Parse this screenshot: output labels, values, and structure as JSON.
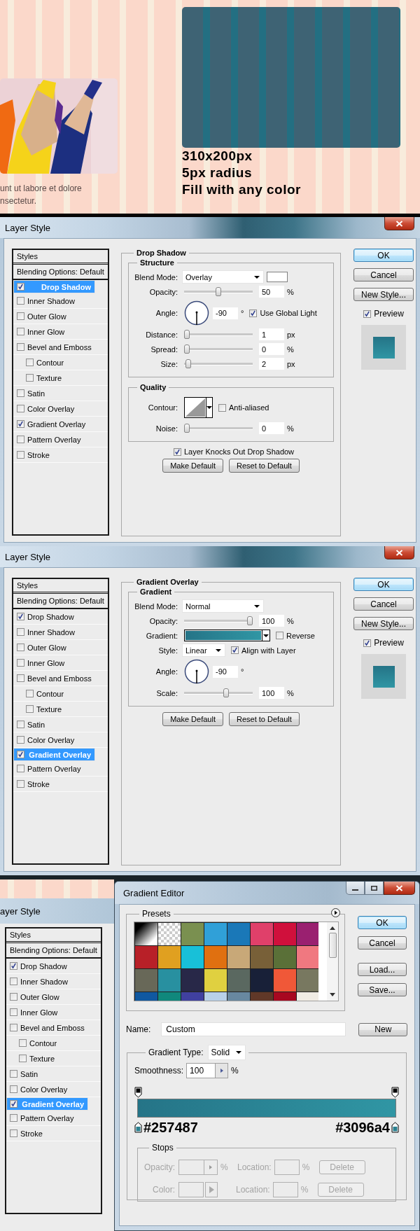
{
  "page_mockup": {
    "excerpt_lines": [
      "unt ut labore et dolore",
      "nsectetur."
    ],
    "box_notes": [
      "310x200px",
      "5px radius",
      "Fill with any color"
    ]
  },
  "dialogs": [
    {
      "title": "Layer Style",
      "styles_header": "Styles",
      "blending": "Blending Options: Default",
      "styles": [
        {
          "label": "Drop Shadow",
          "checked": true,
          "selected": true
        },
        {
          "label": "Inner Shadow",
          "checked": false,
          "selected": false
        },
        {
          "label": "Outer Glow",
          "checked": false,
          "selected": false
        },
        {
          "label": "Inner Glow",
          "checked": false,
          "selected": false
        },
        {
          "label": "Bevel and Emboss",
          "checked": false,
          "selected": false,
          "children": [
            {
              "label": "Contour",
              "checked": false,
              "selected": false
            },
            {
              "label": "Texture",
              "checked": false,
              "selected": false
            }
          ]
        },
        {
          "label": "Satin",
          "checked": false,
          "selected": false
        },
        {
          "label": "Color Overlay",
          "checked": false,
          "selected": false
        },
        {
          "label": "Gradient Overlay",
          "checked": true,
          "selected": false
        },
        {
          "label": "Pattern Overlay",
          "checked": false,
          "selected": false
        },
        {
          "label": "Stroke",
          "checked": false,
          "selected": false
        }
      ],
      "panel": {
        "title": "Drop Shadow",
        "groups": [
          {
            "title": "Structure",
            "rows": [
              {
                "kind": "select",
                "label": "Blend Mode:",
                "value": "Overlay",
                "color_swatch": true
              },
              {
                "kind": "slider",
                "label": "Opacity:",
                "value": "50",
                "unit": "%",
                "level": 0.5
              },
              {
                "kind": "angle",
                "label": "Angle:",
                "value": "-90",
                "unit": "°",
                "checkbox": {
                  "label": "Use Global Light",
                  "checked": true
                }
              },
              {
                "kind": "slider",
                "label": "Distance:",
                "value": "1",
                "unit": "px",
                "level": 0
              },
              {
                "kind": "slider",
                "label": "Spread:",
                "value": "0",
                "unit": "%",
                "level": 0
              },
              {
                "kind": "slider",
                "label": "Size:",
                "value": "2",
                "unit": "px",
                "level": 0.02
              }
            ]
          },
          {
            "title": "Quality",
            "rows": [
              {
                "kind": "contour",
                "label": "Contour:",
                "checkbox": {
                  "label": "Anti-aliased",
                  "checked": false
                }
              },
              {
                "kind": "slider",
                "label": "Noise:",
                "value": "0",
                "unit": "%",
                "level": 0
              }
            ]
          }
        ],
        "options": [
          {
            "label": "Layer Knocks Out Drop Shadow",
            "checked": true
          }
        ],
        "buttons": [
          "Make Default",
          "Reset to Default"
        ]
      },
      "buttons": [
        {
          "label": "OK",
          "default": true
        },
        {
          "label": "Cancel",
          "default": false
        },
        {
          "label": "New Style...",
          "default": false
        }
      ],
      "preview": {
        "label": "Preview",
        "checked": true
      }
    },
    {
      "title": "Layer Style",
      "styles_header": "Styles",
      "blending": "Blending Options: Default",
      "styles": [
        {
          "label": "Drop Shadow",
          "checked": true,
          "selected": false
        },
        {
          "label": "Inner Shadow",
          "checked": false,
          "selected": false
        },
        {
          "label": "Outer Glow",
          "checked": false,
          "selected": false
        },
        {
          "label": "Inner Glow",
          "checked": false,
          "selected": false
        },
        {
          "label": "Bevel and Emboss",
          "checked": false,
          "selected": false,
          "children": [
            {
              "label": "Contour",
              "checked": false,
              "selected": false
            },
            {
              "label": "Texture",
              "checked": false,
              "selected": false
            }
          ]
        },
        {
          "label": "Satin",
          "checked": false,
          "selected": false
        },
        {
          "label": "Color Overlay",
          "checked": false,
          "selected": false
        },
        {
          "label": "Gradient Overlay",
          "checked": true,
          "selected": true
        },
        {
          "label": "Pattern Overlay",
          "checked": false,
          "selected": false
        },
        {
          "label": "Stroke",
          "checked": false,
          "selected": false
        }
      ],
      "panel": {
        "title": "Gradient Overlay",
        "groups": [
          {
            "title": "Gradient",
            "rows": [
              {
                "kind": "select",
                "label": "Blend Mode:",
                "value": "Normal"
              },
              {
                "kind": "slider",
                "label": "Opacity:",
                "value": "100",
                "unit": "%",
                "level": 1
              },
              {
                "kind": "gradient",
                "label": "Gradient:",
                "checkbox": {
                  "label": "Reverse",
                  "checked": false
                }
              },
              {
                "kind": "select",
                "label": "Style:",
                "value": "Linear",
                "checkbox": {
                  "label": "Align with Layer",
                  "checked": true
                }
              },
              {
                "kind": "angle",
                "label": "Angle:",
                "value": "-90",
                "unit": "°"
              },
              {
                "kind": "slider",
                "label": "Scale:",
                "value": "100",
                "unit": "%",
                "level": 0.62
              }
            ]
          }
        ],
        "buttons": [
          "Make Default",
          "Reset to Default"
        ]
      },
      "buttons": [
        {
          "label": "OK",
          "default": true
        },
        {
          "label": "Cancel",
          "default": false
        },
        {
          "label": "New Style...",
          "default": false
        }
      ],
      "preview": {
        "label": "Preview",
        "checked": true
      }
    }
  ],
  "background_dialog": {
    "title": "ayer Style",
    "styles_header": "Styles",
    "blending": "Blending Options: Default",
    "styles": [
      {
        "label": "Drop Shadow",
        "checked": true,
        "selected": false
      },
      {
        "label": "Inner Shadow",
        "checked": false,
        "selected": false
      },
      {
        "label": "Outer Glow",
        "checked": false,
        "selected": false
      },
      {
        "label": "Inner Glow",
        "checked": false,
        "selected": false
      },
      {
        "label": "Bevel and Emboss",
        "checked": false,
        "selected": false,
        "children": [
          {
            "label": "Contour",
            "checked": false,
            "selected": false
          },
          {
            "label": "Texture",
            "checked": false,
            "selected": false
          }
        ]
      },
      {
        "label": "Satin",
        "checked": false,
        "selected": false
      },
      {
        "label": "Color Overlay",
        "checked": false,
        "selected": false
      },
      {
        "label": "Gradient Overlay",
        "checked": true,
        "selected": true
      },
      {
        "label": "Pattern Overlay",
        "checked": false,
        "selected": false
      },
      {
        "label": "Stroke",
        "checked": false,
        "selected": false
      }
    ]
  },
  "gradient_editor": {
    "title": "Gradient Editor",
    "presets": {
      "title": "Presets",
      "swatches": [
        {
          "kind": "black-white"
        },
        {
          "kind": "transparent"
        },
        {
          "kind": "solid",
          "color": "#7a9050"
        },
        {
          "kind": "solid",
          "color": "#30a0d8"
        },
        {
          "kind": "solid",
          "color": "#1a78b8"
        },
        {
          "kind": "solid",
          "color": "#e0406a"
        },
        {
          "kind": "solid",
          "color": "#d0103c"
        },
        {
          "kind": "solid",
          "color": "#9a2070"
        },
        {
          "kind": "solid",
          "color": "#b82028"
        },
        {
          "kind": "solid",
          "color": "#e0a020"
        },
        {
          "kind": "solid",
          "color": "#18c0d8"
        },
        {
          "kind": "solid",
          "color": "#e07010"
        },
        {
          "kind": "solid",
          "color": "#c8a878"
        },
        {
          "kind": "solid",
          "color": "#786038"
        },
        {
          "kind": "solid",
          "color": "#5a7038"
        },
        {
          "kind": "solid",
          "color": "#f07880"
        },
        {
          "kind": "solid",
          "color": "#686858"
        },
        {
          "kind": "solid",
          "color": "#2890a0"
        },
        {
          "kind": "solid",
          "color": "#282848"
        },
        {
          "kind": "solid",
          "color": "#e0d040"
        },
        {
          "kind": "solid",
          "color": "#5a6860"
        },
        {
          "kind": "solid",
          "color": "#182038"
        },
        {
          "kind": "solid",
          "color": "#f05838"
        },
        {
          "kind": "solid",
          "color": "#787860"
        },
        {
          "kind": "solid",
          "color": "#1058a0"
        },
        {
          "kind": "solid",
          "color": "#10887c"
        },
        {
          "kind": "solid",
          "color": "#4040a0"
        },
        {
          "kind": "solid",
          "color": "#b8d0e8"
        },
        {
          "kind": "solid",
          "color": "#6888a0"
        },
        {
          "kind": "solid",
          "color": "#603828"
        },
        {
          "kind": "solid",
          "color": "#a80820"
        },
        {
          "kind": "solid",
          "color": "#f0ece4"
        }
      ]
    },
    "buttons": [
      {
        "label": "OK",
        "default": true
      },
      {
        "label": "Cancel",
        "default": false
      },
      {
        "label": "Load...",
        "default": false
      },
      {
        "label": "Save...",
        "default": false
      }
    ],
    "name_field": {
      "label": "Name:",
      "value": "Custom"
    },
    "new_button": "New",
    "gradient_type": {
      "label": "Gradient Type:",
      "value": "Solid"
    },
    "smoothness": {
      "label": "Smoothness:",
      "value": "100",
      "unit": "%"
    },
    "stop_annotations": [
      "#257487",
      "#3096a4"
    ],
    "stops": {
      "title": "Stops",
      "disabled": true,
      "rows": [
        {
          "kind": "spinner",
          "label": "Opacity:",
          "unit": "%",
          "location_label": "Location:",
          "location_unit": "%",
          "button": "Delete"
        },
        {
          "kind": "color",
          "label": "Color:",
          "location_label": "Location:",
          "location_unit": "%",
          "button": "Delete"
        }
      ]
    }
  }
}
